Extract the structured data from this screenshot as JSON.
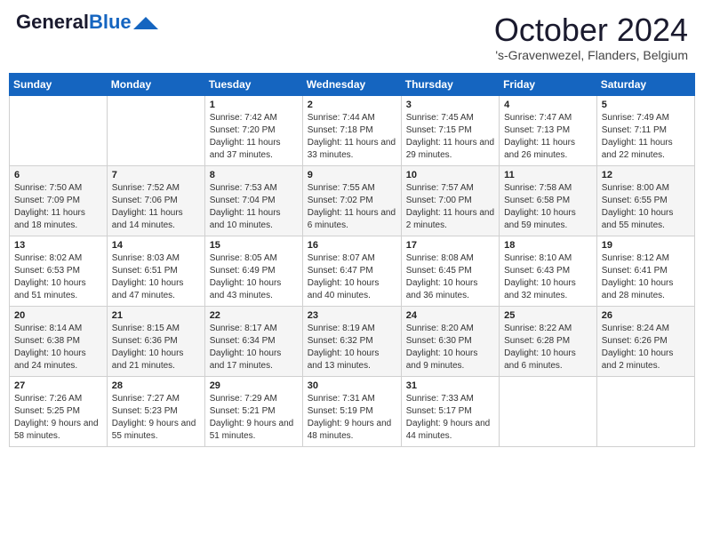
{
  "header": {
    "logo_general": "General",
    "logo_blue": "Blue",
    "month_title": "October 2024",
    "location": "'s-Gravenwezel, Flanders, Belgium"
  },
  "weekdays": [
    "Sunday",
    "Monday",
    "Tuesday",
    "Wednesday",
    "Thursday",
    "Friday",
    "Saturday"
  ],
  "weeks": [
    [
      {
        "day": "",
        "info": ""
      },
      {
        "day": "",
        "info": ""
      },
      {
        "day": "1",
        "info": "Sunrise: 7:42 AM\nSunset: 7:20 PM\nDaylight: 11 hours and 37 minutes."
      },
      {
        "day": "2",
        "info": "Sunrise: 7:44 AM\nSunset: 7:18 PM\nDaylight: 11 hours and 33 minutes."
      },
      {
        "day": "3",
        "info": "Sunrise: 7:45 AM\nSunset: 7:15 PM\nDaylight: 11 hours and 29 minutes."
      },
      {
        "day": "4",
        "info": "Sunrise: 7:47 AM\nSunset: 7:13 PM\nDaylight: 11 hours and 26 minutes."
      },
      {
        "day": "5",
        "info": "Sunrise: 7:49 AM\nSunset: 7:11 PM\nDaylight: 11 hours and 22 minutes."
      }
    ],
    [
      {
        "day": "6",
        "info": "Sunrise: 7:50 AM\nSunset: 7:09 PM\nDaylight: 11 hours and 18 minutes."
      },
      {
        "day": "7",
        "info": "Sunrise: 7:52 AM\nSunset: 7:06 PM\nDaylight: 11 hours and 14 minutes."
      },
      {
        "day": "8",
        "info": "Sunrise: 7:53 AM\nSunset: 7:04 PM\nDaylight: 11 hours and 10 minutes."
      },
      {
        "day": "9",
        "info": "Sunrise: 7:55 AM\nSunset: 7:02 PM\nDaylight: 11 hours and 6 minutes."
      },
      {
        "day": "10",
        "info": "Sunrise: 7:57 AM\nSunset: 7:00 PM\nDaylight: 11 hours and 2 minutes."
      },
      {
        "day": "11",
        "info": "Sunrise: 7:58 AM\nSunset: 6:58 PM\nDaylight: 10 hours and 59 minutes."
      },
      {
        "day": "12",
        "info": "Sunrise: 8:00 AM\nSunset: 6:55 PM\nDaylight: 10 hours and 55 minutes."
      }
    ],
    [
      {
        "day": "13",
        "info": "Sunrise: 8:02 AM\nSunset: 6:53 PM\nDaylight: 10 hours and 51 minutes."
      },
      {
        "day": "14",
        "info": "Sunrise: 8:03 AM\nSunset: 6:51 PM\nDaylight: 10 hours and 47 minutes."
      },
      {
        "day": "15",
        "info": "Sunrise: 8:05 AM\nSunset: 6:49 PM\nDaylight: 10 hours and 43 minutes."
      },
      {
        "day": "16",
        "info": "Sunrise: 8:07 AM\nSunset: 6:47 PM\nDaylight: 10 hours and 40 minutes."
      },
      {
        "day": "17",
        "info": "Sunrise: 8:08 AM\nSunset: 6:45 PM\nDaylight: 10 hours and 36 minutes."
      },
      {
        "day": "18",
        "info": "Sunrise: 8:10 AM\nSunset: 6:43 PM\nDaylight: 10 hours and 32 minutes."
      },
      {
        "day": "19",
        "info": "Sunrise: 8:12 AM\nSunset: 6:41 PM\nDaylight: 10 hours and 28 minutes."
      }
    ],
    [
      {
        "day": "20",
        "info": "Sunrise: 8:14 AM\nSunset: 6:38 PM\nDaylight: 10 hours and 24 minutes."
      },
      {
        "day": "21",
        "info": "Sunrise: 8:15 AM\nSunset: 6:36 PM\nDaylight: 10 hours and 21 minutes."
      },
      {
        "day": "22",
        "info": "Sunrise: 8:17 AM\nSunset: 6:34 PM\nDaylight: 10 hours and 17 minutes."
      },
      {
        "day": "23",
        "info": "Sunrise: 8:19 AM\nSunset: 6:32 PM\nDaylight: 10 hours and 13 minutes."
      },
      {
        "day": "24",
        "info": "Sunrise: 8:20 AM\nSunset: 6:30 PM\nDaylight: 10 hours and 9 minutes."
      },
      {
        "day": "25",
        "info": "Sunrise: 8:22 AM\nSunset: 6:28 PM\nDaylight: 10 hours and 6 minutes."
      },
      {
        "day": "26",
        "info": "Sunrise: 8:24 AM\nSunset: 6:26 PM\nDaylight: 10 hours and 2 minutes."
      }
    ],
    [
      {
        "day": "27",
        "info": "Sunrise: 7:26 AM\nSunset: 5:25 PM\nDaylight: 9 hours and 58 minutes."
      },
      {
        "day": "28",
        "info": "Sunrise: 7:27 AM\nSunset: 5:23 PM\nDaylight: 9 hours and 55 minutes."
      },
      {
        "day": "29",
        "info": "Sunrise: 7:29 AM\nSunset: 5:21 PM\nDaylight: 9 hours and 51 minutes."
      },
      {
        "day": "30",
        "info": "Sunrise: 7:31 AM\nSunset: 5:19 PM\nDaylight: 9 hours and 48 minutes."
      },
      {
        "day": "31",
        "info": "Sunrise: 7:33 AM\nSunset: 5:17 PM\nDaylight: 9 hours and 44 minutes."
      },
      {
        "day": "",
        "info": ""
      },
      {
        "day": "",
        "info": ""
      }
    ]
  ]
}
